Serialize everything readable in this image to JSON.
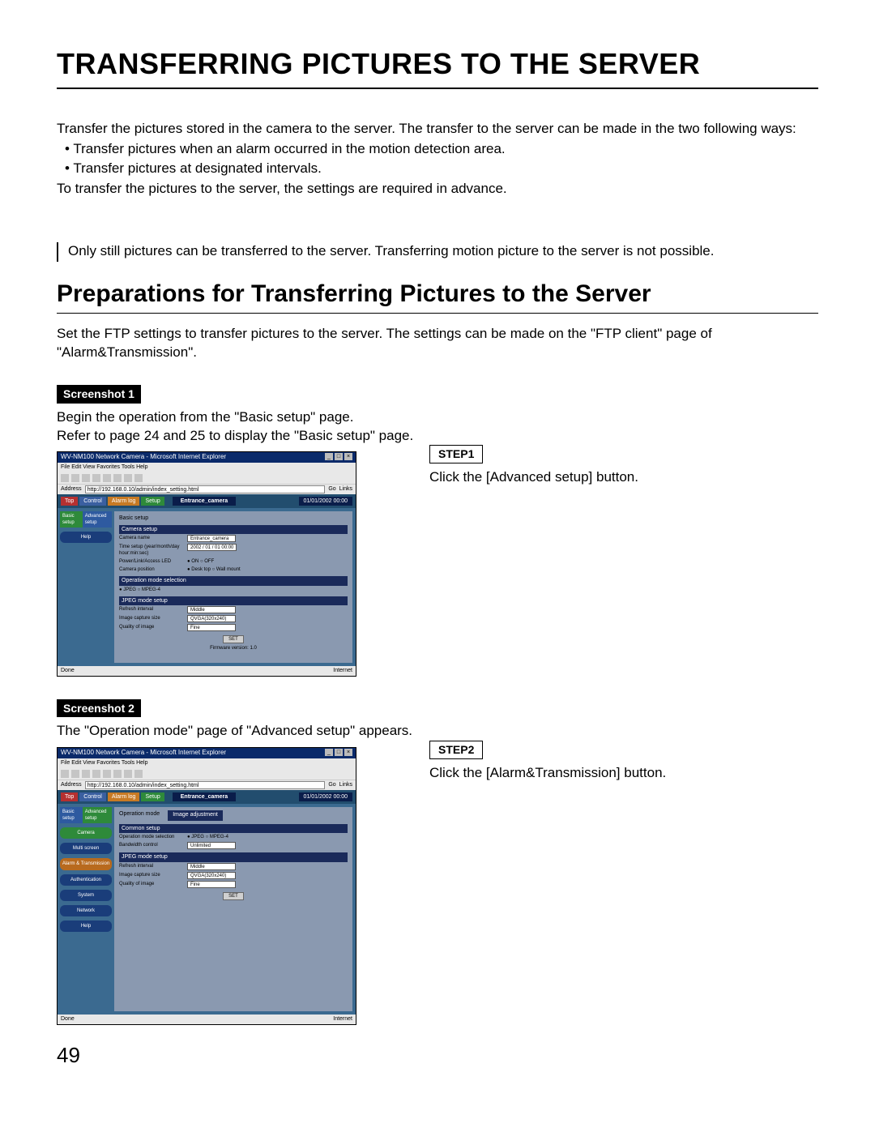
{
  "title": "TRANSFERRING PICTURES TO THE SERVER",
  "intro": {
    "p1": "Transfer the pictures stored in the camera to the server. The transfer to the server can be made in the two following ways:",
    "b1": "• Transfer pictures when an alarm occurred in the motion detection area.",
    "b2": "• Transfer pictures at designated intervals.",
    "p2": "To transfer the pictures to the server, the settings are required in advance."
  },
  "note": "Only still pictures can be transferred to the server. Transferring motion picture to the server is not possible.",
  "section_title": "Preparations for Transferring Pictures to the Server",
  "section_intro": "Set the FTP settings to transfer pictures to the server. The settings can be made on the \"FTP client\" page of \"Alarm&Transmission\".",
  "shot1": {
    "label": "Screenshot 1",
    "p1": "Begin the operation from the \"Basic setup\" page.",
    "p2": "Refer to page 24 and 25 to display the \"Basic setup\" page."
  },
  "step1": {
    "label": "STEP1",
    "text": "Click the [Advanced setup] button."
  },
  "shot2": {
    "label": "Screenshot 2",
    "p1": "The \"Operation mode\" page of \"Advanced setup\" appears."
  },
  "step2": {
    "label": "STEP2",
    "text": "Click the [Alarm&Transmission] button."
  },
  "page_number": "49",
  "mock": {
    "win_title": "WV-NM100 Network Camera - Microsoft Internet Explorer",
    "menubar": "File  Edit  View  Favorites  Tools  Help",
    "addr_label": "Address",
    "addr_url": "http://192.168.0.10/admin/index_setting.html",
    "go": "Go",
    "links": "Links",
    "tabs": {
      "top": "Top",
      "control": "Control",
      "alarm_log": "Alarm log",
      "setup": "Setup"
    },
    "cam_label": "Entrance_camera",
    "timestamp": "01/01/2002  00:00",
    "sub_basic": "Basic setup",
    "sub_adv": "Advanced setup",
    "help": "Help",
    "panel1": {
      "title": "Basic setup",
      "h1": "Camera setup",
      "r1l": "Camera name",
      "r1v": "Entrance_camera",
      "r2l": "Time setup (year/month/day hour:min:sec)",
      "r2v": "2002 / 01 / 01  00:00",
      "r3l": "Power/Link/Access LED",
      "r3v": "● ON  ○ OFF",
      "r4l": "Camera position",
      "r4v": "● Desk top  ○ Wall mount",
      "h2": "Operation mode selection",
      "r5v": "● JPEG  ○ MPEG-4",
      "h3": "JPEG mode setup",
      "r6l": "Refresh interval",
      "r6v": "Middle",
      "r7l": "Image capture size",
      "r7v": "QVGA(320x240)",
      "r8l": "Quality of image",
      "r8v": "Fine",
      "set": "SET",
      "fw": "Firmware version: 1.0"
    },
    "status_done": "Done",
    "status_net": "Internet",
    "side2": {
      "camera": "Camera",
      "multi": "Multi screen",
      "alarmtrans": "Alarm & Transmission",
      "auth": "Authentication",
      "system": "System",
      "network": "Network"
    },
    "panel2": {
      "title": "Operation mode",
      "tab_img": "Image adjustment",
      "h1": "Common setup",
      "r1l": "Operation mode selection",
      "r1v": "● JPEG ○ MPEG-4",
      "r2l": "Bandwidth control",
      "r2v": "Unlimited",
      "h2": "JPEG mode setup",
      "r3l": "Refresh interval",
      "r3v": "Middle",
      "r4l": "Image capture size",
      "r4v": "QVGA(320x240)",
      "r5l": "Quality of image",
      "r5v": "Fine"
    }
  }
}
